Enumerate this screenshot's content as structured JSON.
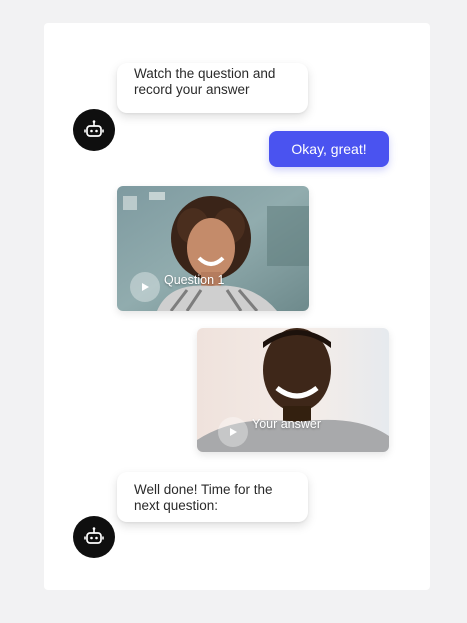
{
  "chat": {
    "bot_message_1": "Watch the question and\nrecord your answer",
    "user_reply": "Okay, great!",
    "question_video_label": "Question 1",
    "answer_video_label": "Your answer",
    "bot_message_2": "Well done! Time for the\nnext question:"
  },
  "icons": {
    "bot_avatar": "robot-icon",
    "play": "play-icon"
  },
  "colors": {
    "reply_bubble": "#4a53f0",
    "avatar_bg": "#0f0f0f",
    "background": "#f2f2f3"
  }
}
